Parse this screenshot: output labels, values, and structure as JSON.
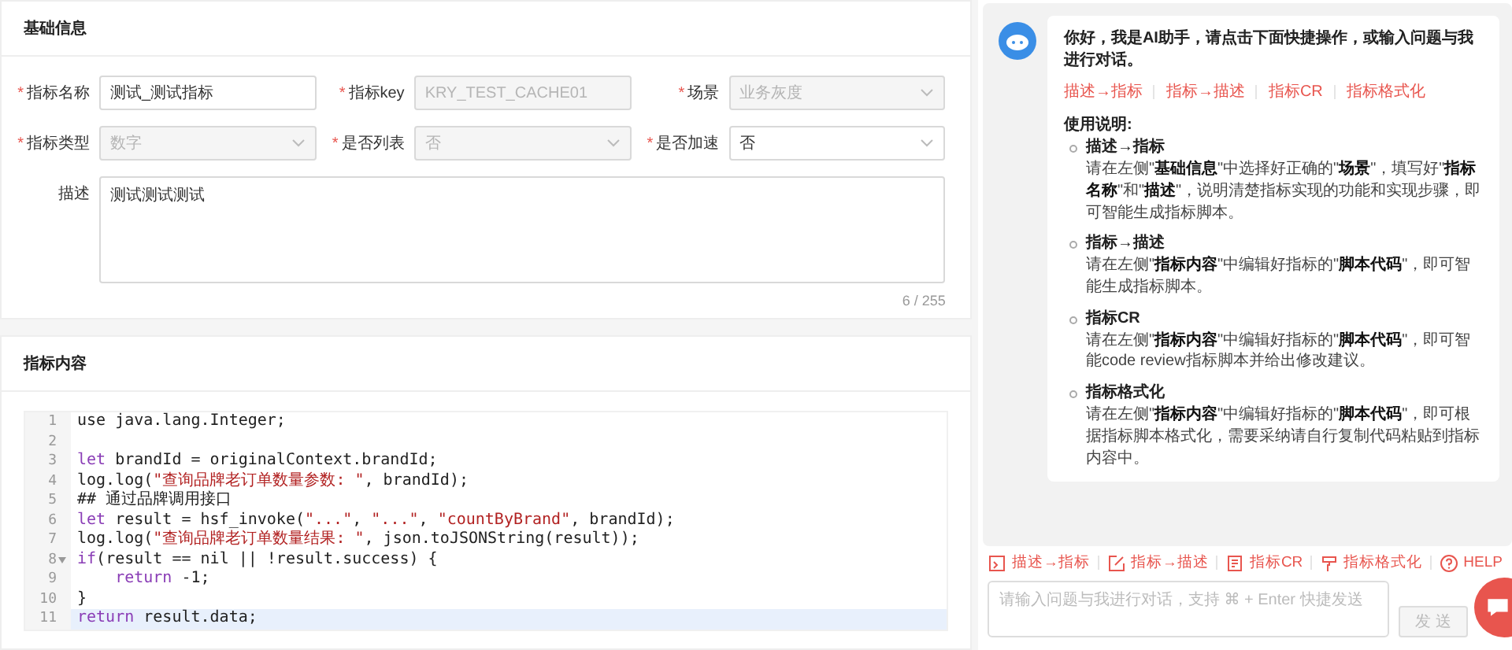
{
  "basic_info": {
    "title": "基础信息",
    "fields": [
      {
        "label": "指标名称",
        "required_mark": "*",
        "kind": "input",
        "value": "测试_测试指标",
        "disabled": false
      },
      {
        "label": "指标key",
        "required_mark": "*",
        "kind": "input",
        "value": "KRY_TEST_CACHE01",
        "disabled": true
      },
      {
        "label": "场景",
        "required_mark": "*",
        "kind": "select",
        "value": "业务灰度",
        "disabled": true
      },
      {
        "label": "指标类型",
        "required_mark": "*",
        "kind": "select",
        "value": "数字",
        "disabled": true
      },
      {
        "label": "是否列表",
        "required_mark": "*",
        "kind": "select",
        "value": "否",
        "disabled": true
      },
      {
        "label": "是否加速",
        "required_mark": "*",
        "kind": "select",
        "value": "否",
        "disabled": false
      }
    ],
    "description": {
      "label": "描述",
      "value": "测试测试测试",
      "counter": "6 / 255"
    }
  },
  "content": {
    "title": "指标内容",
    "code_lines": [
      {
        "number": "1",
        "foldable": false,
        "current": false,
        "tokens": [
          {
            "kind": "plain",
            "text": "use java.lang.Integer;"
          }
        ]
      },
      {
        "number": "2",
        "foldable": false,
        "current": false
      },
      {
        "number": "3",
        "foldable": false,
        "current": false,
        "tokens": [
          {
            "kind": "keyword",
            "text": "let"
          },
          {
            "kind": "plain",
            "text": " brandId = originalContext.brandId;"
          }
        ]
      },
      {
        "number": "4",
        "foldable": false,
        "current": false,
        "tokens": [
          {
            "kind": "plain",
            "text": "log.log("
          },
          {
            "kind": "string",
            "text": "\"查询品牌老订单数量参数: \""
          },
          {
            "kind": "plain",
            "text": ", brandId);"
          }
        ]
      },
      {
        "number": "5",
        "foldable": false,
        "current": false,
        "tokens": [
          {
            "kind": "plain",
            "text": "## 通过品牌调用接口"
          }
        ]
      },
      {
        "number": "6",
        "foldable": false,
        "current": false,
        "tokens": [
          {
            "kind": "keyword",
            "text": "let"
          },
          {
            "kind": "plain",
            "text": " result = hsf_invoke("
          },
          {
            "kind": "string",
            "text": "\"...\""
          },
          {
            "kind": "plain",
            "text": ", "
          },
          {
            "kind": "string",
            "text": "\"...\""
          },
          {
            "kind": "plain",
            "text": ", "
          },
          {
            "kind": "string",
            "text": "\"countByBrand\""
          },
          {
            "kind": "plain",
            "text": ", brandId);"
          }
        ]
      },
      {
        "number": "7",
        "foldable": false,
        "current": false,
        "tokens": [
          {
            "kind": "plain",
            "text": "log.log("
          },
          {
            "kind": "string",
            "text": "\"查询品牌老订单数量结果: \""
          },
          {
            "kind": "plain",
            "text": ", json.toJSONString(result));"
          }
        ]
      },
      {
        "number": "8",
        "foldable": true,
        "current": false,
        "tokens": [
          {
            "kind": "keyword",
            "text": "if"
          },
          {
            "kind": "plain",
            "text": "(result == nil || !result.success) {"
          }
        ]
      },
      {
        "number": "9",
        "foldable": false,
        "current": false,
        "tokens": [
          {
            "kind": "keyword",
            "text": "    return"
          },
          {
            "kind": "plain",
            "text": " -1;"
          }
        ]
      },
      {
        "number": "10",
        "foldable": false,
        "current": false,
        "tokens": [
          {
            "kind": "plain",
            "text": "}"
          }
        ]
      },
      {
        "number": "11",
        "foldable": false,
        "current": true,
        "tokens": [
          {
            "kind": "keyword",
            "text": "return"
          },
          {
            "kind": "plain",
            "text": " result.data;"
          }
        ]
      }
    ]
  },
  "assistant": {
    "greeting": "你好，我是AI助手，请点击下面快捷操作，或输入问题与我进行对话。",
    "quick_actions": [
      "描述→指标",
      "指标→描述",
      "指标CR",
      "指标格式化"
    ],
    "usage_title": "使用说明:",
    "usage": [
      {
        "title": "描述→指标",
        "text": "请在左侧\"**基础信息**\"中选择好正确的\"**场景**\"，填写好\"**指标名称**\"和\"**描述**\"，说明清楚指标实现的功能和实现步骤，即可智能生成指标脚本。"
      },
      {
        "title": "指标→描述",
        "text": "请在左侧\"**指标内容**\"中编辑好指标的\"**脚本代码**\"，即可智能生成指标脚本。"
      },
      {
        "title": "指标CR",
        "text": "请在左侧\"**指标内容**\"中编辑好指标的\"**脚本代码**\"，即可智能code review指标脚本并给出修改建议。"
      },
      {
        "title": "指标格式化",
        "text": "请在左侧\"**指标内容**\"中编辑好指标的\"**脚本代码**\"，即可根据指标脚本格式化，需要采纳请自行复制代码粘贴到指标内容中。"
      }
    ],
    "toolbar": [
      {
        "kind": "desc",
        "label": "描述→指标"
      },
      {
        "kind": "edit",
        "label": "指标→描述"
      },
      {
        "kind": "review",
        "label": "指标CR"
      },
      {
        "kind": "format",
        "label": "指标格式化"
      },
      {
        "kind": "help",
        "label": "HELP"
      }
    ],
    "input": {
      "placeholder": "请输入问题与我进行对话，支持 ⌘ + Enter 快捷发送"
    },
    "send_button": {
      "label": "发 送",
      "disabled": true
    }
  }
}
